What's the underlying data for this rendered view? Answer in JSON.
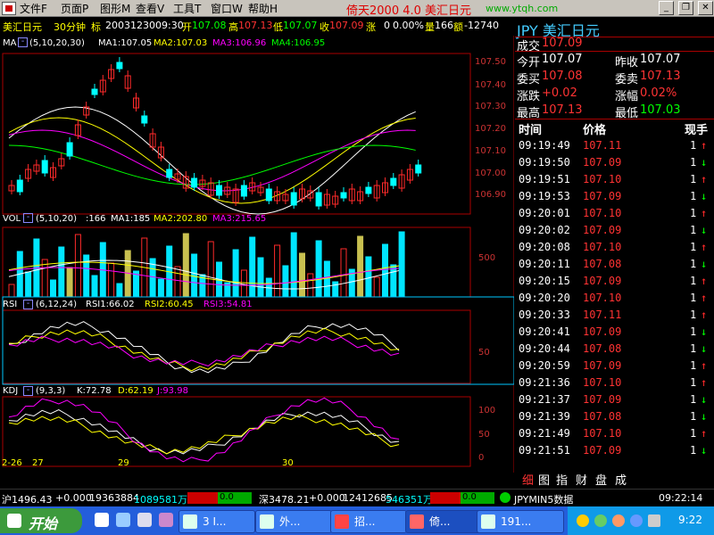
{
  "menu": {
    "items": [
      "文件F",
      "页面P",
      "图形M",
      "查看V",
      "工具T",
      "窗口W",
      "帮助H"
    ],
    "app_title": "倚天2000  4.0",
    "app_sub": "美汇日元",
    "url": "www.ytqh.com"
  },
  "info": {
    "symbol": "美汇日元",
    "period": "30分钟",
    "flag": "标",
    "date": "20031230",
    "time": "09:30",
    "open_label": "开",
    "open": "107.08",
    "high_label": "高",
    "high": "107.13",
    "low_label": "低",
    "low": "107.07",
    "close_label": "收",
    "close": "107.09",
    "chg_label": "涨",
    "chg": "0",
    "pct": "0.00%",
    "vol_label": "量",
    "vol": "166",
    "amt_label": "额",
    "amt": "-12740"
  },
  "ma": {
    "label": "MA",
    "params": "(5,10,20,30)",
    "ma1": "MA1:107.05",
    "ma2": "MA2:107.03",
    "ma3": "MA3:106.96",
    "ma4": "MA4:106.95",
    "yticks": [
      "107.50",
      "107.40",
      "107.30",
      "107.20",
      "107.10",
      "107.00",
      "106.90"
    ]
  },
  "volp": {
    "label": "VOL",
    "params": "(5,10,20)",
    "cur": ":166",
    "ma1": "MA1:185",
    "ma2": "MA2:202.80",
    "ma3": "MA3:215.65",
    "ytick": "500"
  },
  "rsi": {
    "label": "RSI",
    "params": "(6,12,24)",
    "r1": "RSI1:66.02",
    "r2": "RSI2:60.45",
    "r3": "RSI3:54.81",
    "ytick": "50"
  },
  "kdj": {
    "label": "KDJ",
    "params": "(9,3,3)",
    "k": "K:72.78",
    "d": "D:62.19",
    "j": "J:93.98",
    "yticks": [
      "100",
      "50",
      "0"
    ]
  },
  "xaxis": [
    "2-26",
    "27",
    "29",
    "30"
  ],
  "quote": {
    "title": "JPY 美汇日元",
    "deal_label": "成交",
    "deal": "107.09",
    "open_label": "今开",
    "open": "107.07",
    "prev_label": "昨收",
    "prev": "107.07",
    "buy_label": "委买",
    "buy": "107.08",
    "sell_label": "委卖",
    "sell": "107.13",
    "chg_label": "涨跌",
    "chg": "+0.02",
    "pct_label": "涨幅",
    "pct": "0.02%",
    "high_label": "最高",
    "high": "107.13",
    "low_label": "最低",
    "low": "107.03"
  },
  "ticks": {
    "headers": [
      "时间",
      "价格",
      "现手"
    ],
    "rows": [
      {
        "time": "09:19:49",
        "price": "107.11",
        "vol": "1",
        "dir": "up"
      },
      {
        "time": "09:19:50",
        "price": "107.09",
        "vol": "1",
        "dir": "down"
      },
      {
        "time": "09:19:51",
        "price": "107.10",
        "vol": "1",
        "dir": "up"
      },
      {
        "time": "09:19:53",
        "price": "107.09",
        "vol": "1",
        "dir": "down"
      },
      {
        "time": "09:20:01",
        "price": "107.10",
        "vol": "1",
        "dir": "up"
      },
      {
        "time": "09:20:02",
        "price": "107.09",
        "vol": "1",
        "dir": "down"
      },
      {
        "time": "09:20:08",
        "price": "107.10",
        "vol": "1",
        "dir": "up"
      },
      {
        "time": "09:20:11",
        "price": "107.08",
        "vol": "1",
        "dir": "down"
      },
      {
        "time": "09:20:15",
        "price": "107.09",
        "vol": "1",
        "dir": "up"
      },
      {
        "time": "09:20:20",
        "price": "107.10",
        "vol": "1",
        "dir": "up"
      },
      {
        "time": "09:20:33",
        "price": "107.11",
        "vol": "1",
        "dir": "up"
      },
      {
        "time": "09:20:41",
        "price": "107.09",
        "vol": "1",
        "dir": "down"
      },
      {
        "time": "09:20:44",
        "price": "107.08",
        "vol": "1",
        "dir": "down"
      },
      {
        "time": "09:20:59",
        "price": "107.09",
        "vol": "1",
        "dir": "up"
      },
      {
        "time": "09:21:36",
        "price": "107.10",
        "vol": "1",
        "dir": "up"
      },
      {
        "time": "09:21:37",
        "price": "107.09",
        "vol": "1",
        "dir": "down"
      },
      {
        "time": "09:21:39",
        "price": "107.08",
        "vol": "1",
        "dir": "down"
      },
      {
        "time": "09:21:49",
        "price": "107.10",
        "vol": "1",
        "dir": "up"
      },
      {
        "time": "09:21:51",
        "price": "107.09",
        "vol": "1",
        "dir": "down"
      }
    ]
  },
  "tabs": [
    "细",
    "图",
    "指",
    "财",
    "盘",
    "成"
  ],
  "status": {
    "sh": "沪1496.43",
    "sh_chg": "+0.000",
    "sh_vol": "19363884",
    "sh_amt": "1089581万",
    "sh_bar": "0.0",
    "sz": "深3478.21",
    "sz_chg": "+0.000",
    "sz_vol": "12412685",
    "sz_amt": "546351万",
    "sz_bar": "0.0",
    "data_label": "JPYMIN5数据",
    "clock": "09:22:14"
  },
  "taskbar": {
    "start": "开始",
    "buttons": [
      "3 I...",
      "外...",
      "招...",
      "倚...",
      "191..."
    ],
    "time": "9:22"
  },
  "colors": {
    "up": "#ff2a2a",
    "down": "#00ff00",
    "frame": "#aa0000",
    "ma1": "#ffffff",
    "ma2": "#ffff00",
    "ma3": "#ff00ff",
    "ma4": "#00ff00"
  }
}
